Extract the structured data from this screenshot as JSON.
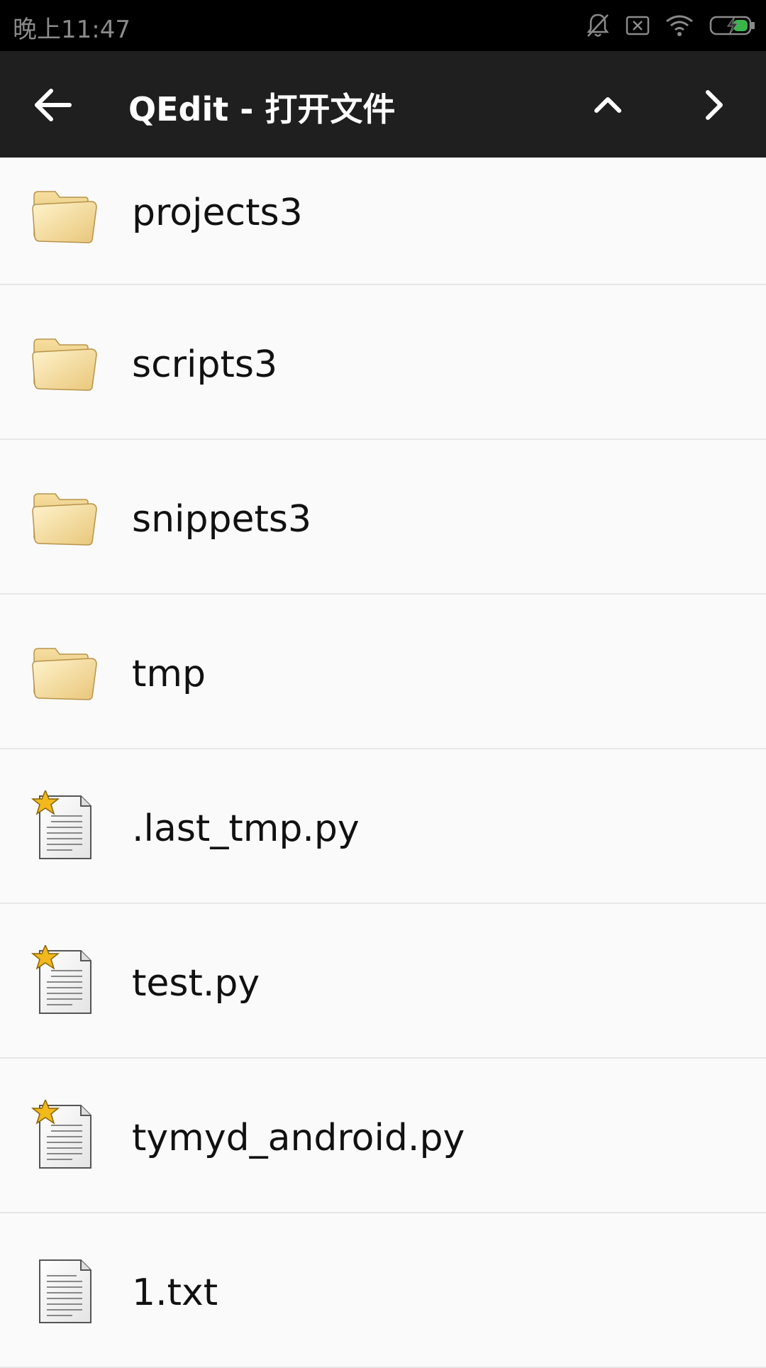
{
  "status_bar": {
    "time": "晚上11:47",
    "icons": [
      "bell-off-icon",
      "sim-error-icon",
      "wifi-icon",
      "battery-charging-icon"
    ]
  },
  "toolbar": {
    "title": "QEdit - 打开文件",
    "back_icon": "arrow-left-icon",
    "up_icon": "chevron-up-icon",
    "forward_icon": "chevron-right-icon"
  },
  "files": [
    {
      "name": "projects3",
      "type": "folder"
    },
    {
      "name": "scripts3",
      "type": "folder"
    },
    {
      "name": "snippets3",
      "type": "folder"
    },
    {
      "name": "tmp",
      "type": "folder"
    },
    {
      "name": ".last_tmp.py",
      "type": "script-file"
    },
    {
      "name": "test.py",
      "type": "script-file"
    },
    {
      "name": "tymyd_android.py",
      "type": "script-file"
    },
    {
      "name": "1.txt",
      "type": "text-file"
    }
  ]
}
